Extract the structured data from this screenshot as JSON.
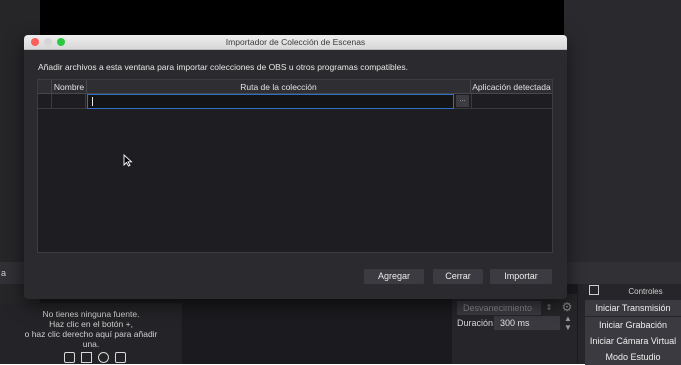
{
  "main_window": {
    "left_stub_label": "a",
    "sources": {
      "empty_lines": [
        "No tienes ninguna fuente.",
        "Haz clic en el botón +,",
        "o haz clic derecho aquí para añadir",
        "una."
      ],
      "icons": [
        "monitor-icon",
        "square-icon",
        "globe-icon",
        "camera-icon"
      ]
    },
    "transitions": {
      "selected": "Desvanecimiento",
      "duration_label": "Duración",
      "duration_value": "300 ms"
    },
    "controls": {
      "title": "Controles",
      "buttons": [
        "Iniciar Transmisión",
        "Iniciar Grabación",
        "Iniciar Cámara Virtual",
        "Modo Estudio"
      ]
    }
  },
  "dialog": {
    "title": "Importador de Colección de Escenas",
    "instructions": "Añadir archivos a esta ventana para importar colecciones de OBS u otros programas compatibles.",
    "columns": [
      "Nombre",
      "Ruta de la colección",
      "Aplicación detectada"
    ],
    "path_value": "",
    "browse_label": "...",
    "buttons": {
      "add": "Agregar",
      "close": "Cerrar",
      "import": "Importar"
    }
  },
  "colors": {
    "accent_focus": "#2f6fc4",
    "dialog_bg": "#2b2b2f",
    "close_light": "#fc5f57",
    "zoom_light": "#2bc840"
  }
}
